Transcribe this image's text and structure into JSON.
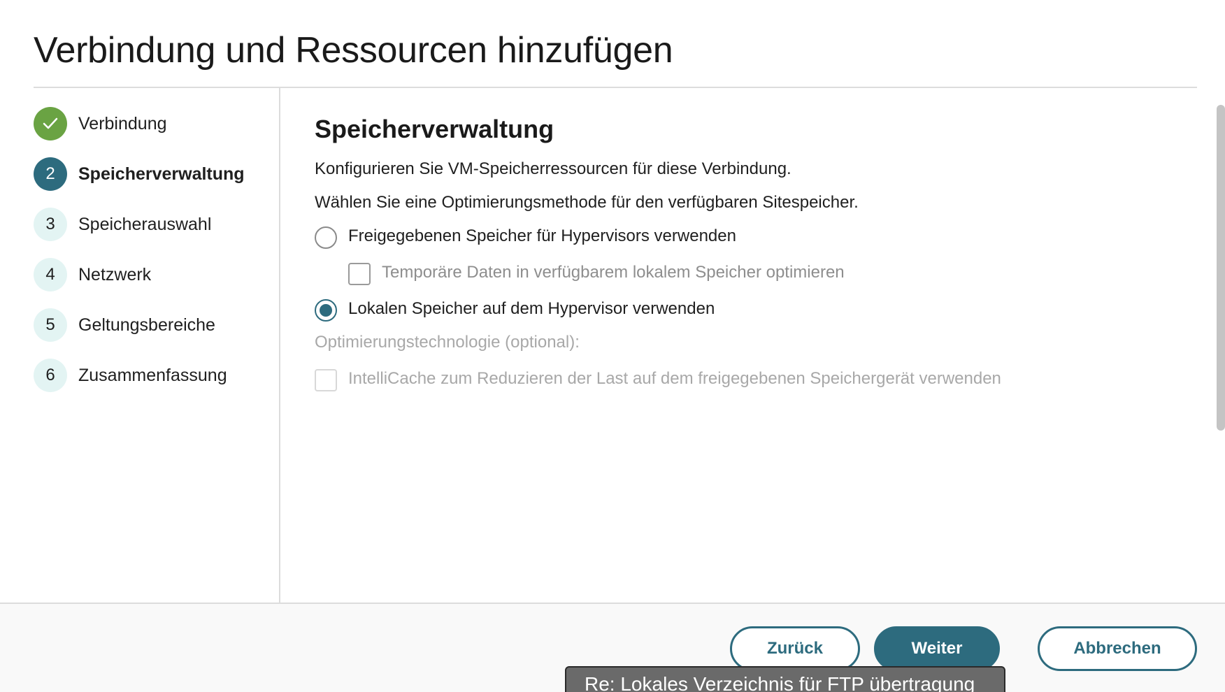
{
  "dialog": {
    "title": "Verbindung und Ressourcen hinzufügen"
  },
  "steps": [
    {
      "number": "",
      "label": "Verbindung",
      "state": "done"
    },
    {
      "number": "2",
      "label": "Speicherverwaltung",
      "state": "active"
    },
    {
      "number": "3",
      "label": "Speicherauswahl",
      "state": "todo"
    },
    {
      "number": "4",
      "label": "Netzwerk",
      "state": "todo"
    },
    {
      "number": "5",
      "label": "Geltungsbereiche",
      "state": "todo"
    },
    {
      "number": "6",
      "label": "Zusammenfassung",
      "state": "todo"
    }
  ],
  "content": {
    "heading": "Speicherverwaltung",
    "intro": "Konfigurieren Sie VM-Speicherressourcen für diese Verbindung.",
    "prompt": "Wählen Sie eine Optimierungsmethode für den verfügbaren Sitespeicher.",
    "option_shared": "Freigegebenen Speicher für Hypervisors verwenden",
    "option_temp": "Temporäre Daten in verfügbarem lokalem Speicher optimieren",
    "option_local": "Lokalen Speicher auf dem Hypervisor verwenden",
    "tech_label": "Optimierungstechnologie (optional):",
    "option_intellicache": "IntelliCache zum Reduzieren der Last auf dem freigegebenen Speichergerät verwenden",
    "selected_option": "option_local"
  },
  "footer": {
    "back_label": "Zurück",
    "next_label": "Weiter",
    "cancel_label": "Abbrechen"
  },
  "tooltip": {
    "text": "Re: Lokales Verzeichnis für FTP übertragung"
  },
  "colors": {
    "accent": "#2d6b7e",
    "done": "#6aa343",
    "step_todo_bg": "#e3f4f3"
  }
}
